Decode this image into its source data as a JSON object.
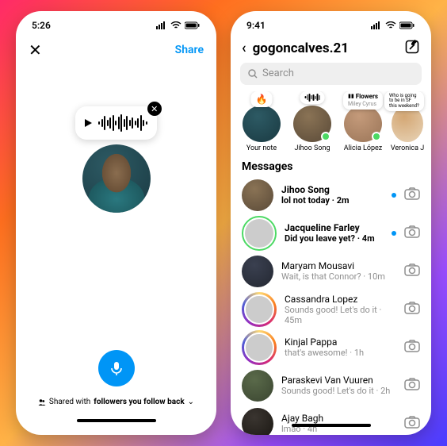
{
  "left": {
    "status": {
      "time": "5:26"
    },
    "header": {
      "share": "Share"
    },
    "footer": {
      "shared_prefix": "Shared with ",
      "shared_audience": "followers you follow back"
    }
  },
  "right": {
    "status": {
      "time": "9:41"
    },
    "header": {
      "username": "gogoncalves.21"
    },
    "search": {
      "placeholder": "Search"
    },
    "tray": [
      {
        "name": "Your note",
        "bubble_icon": "fire"
      },
      {
        "name": "Jihoo Song",
        "bubble_icon": "wave",
        "online": true
      },
      {
        "name": "Alicia López",
        "bubble_title": "Flowers",
        "bubble_sub": "Miley Cyrus",
        "online": true
      },
      {
        "name": "Veronica J",
        "bubble_text": "Who is going to be in SF this weekend?"
      }
    ],
    "section": "Messages",
    "messages": [
      {
        "name": "Jihoo Song",
        "sub": "lol not today · 2m",
        "unread": true,
        "ring": "none"
      },
      {
        "name": "Jacqueline Farley",
        "sub": "Did you leave yet? · 4m",
        "unread": true,
        "ring": "close"
      },
      {
        "name": "Maryam Mousavi",
        "sub": "Wait, is that Connor? · 10m",
        "unread": false,
        "ring": "none"
      },
      {
        "name": "Cassandra Lopez",
        "sub": "Sounds good! Let's do it · 45m",
        "unread": false,
        "ring": "story"
      },
      {
        "name": "Kinjal Pappa",
        "sub": "that's awesome! · 1h",
        "unread": false,
        "ring": "story"
      },
      {
        "name": "Paraskevi Van Vuuren",
        "sub": "Sounds good! Let's do it · 2h",
        "unread": false,
        "ring": "none"
      },
      {
        "name": "Ajay Bagh",
        "sub": "lmao · 4h",
        "unread": false,
        "ring": "none"
      }
    ]
  }
}
